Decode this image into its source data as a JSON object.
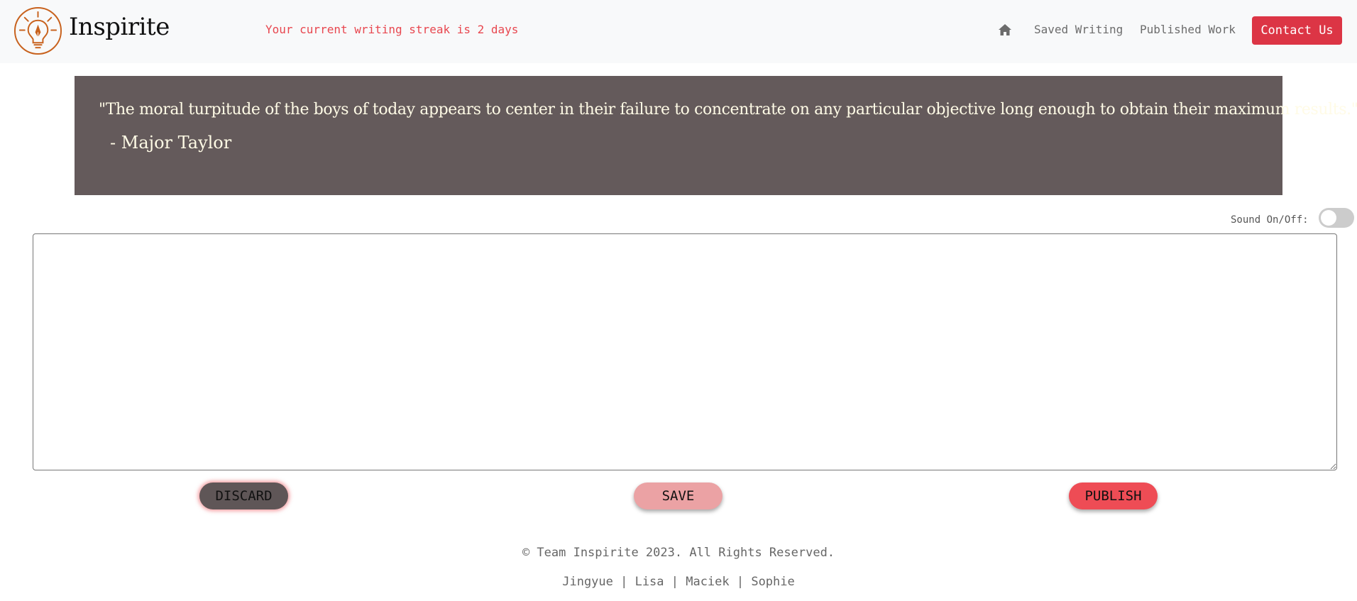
{
  "navbar": {
    "brand": "Inspirite",
    "logo_icon": "lightbulb-pen-icon",
    "streak_text": "Your current writing streak is 2 days",
    "home_icon": "home-icon",
    "links": [
      "Saved Writing",
      "Published Work"
    ],
    "contact_label": "Contact Us"
  },
  "quote": {
    "text": "\"The moral turpitude of the boys of today appears to center in their failure to concentrate on any particular objective long enough to obtain their maximum results.\"",
    "author": "- Major Taylor"
  },
  "sound": {
    "label": "Sound On/Off:",
    "enabled": false
  },
  "editor": {
    "value": "",
    "placeholder": ""
  },
  "actions": {
    "discard": "DISCARD",
    "save": "SAVE",
    "publish": "PUBLISH"
  },
  "footer": {
    "copyright": "© Team Inspirite 2023. All Rights Reserved.",
    "names": "Jingyue | Lisa | Maciek | Sophie"
  },
  "colors": {
    "accent": "#dc3545",
    "streak": "#e8474f",
    "logo": "#c8621e",
    "quote_bg": "#645a5b",
    "quote_text": "#fffbe6"
  }
}
